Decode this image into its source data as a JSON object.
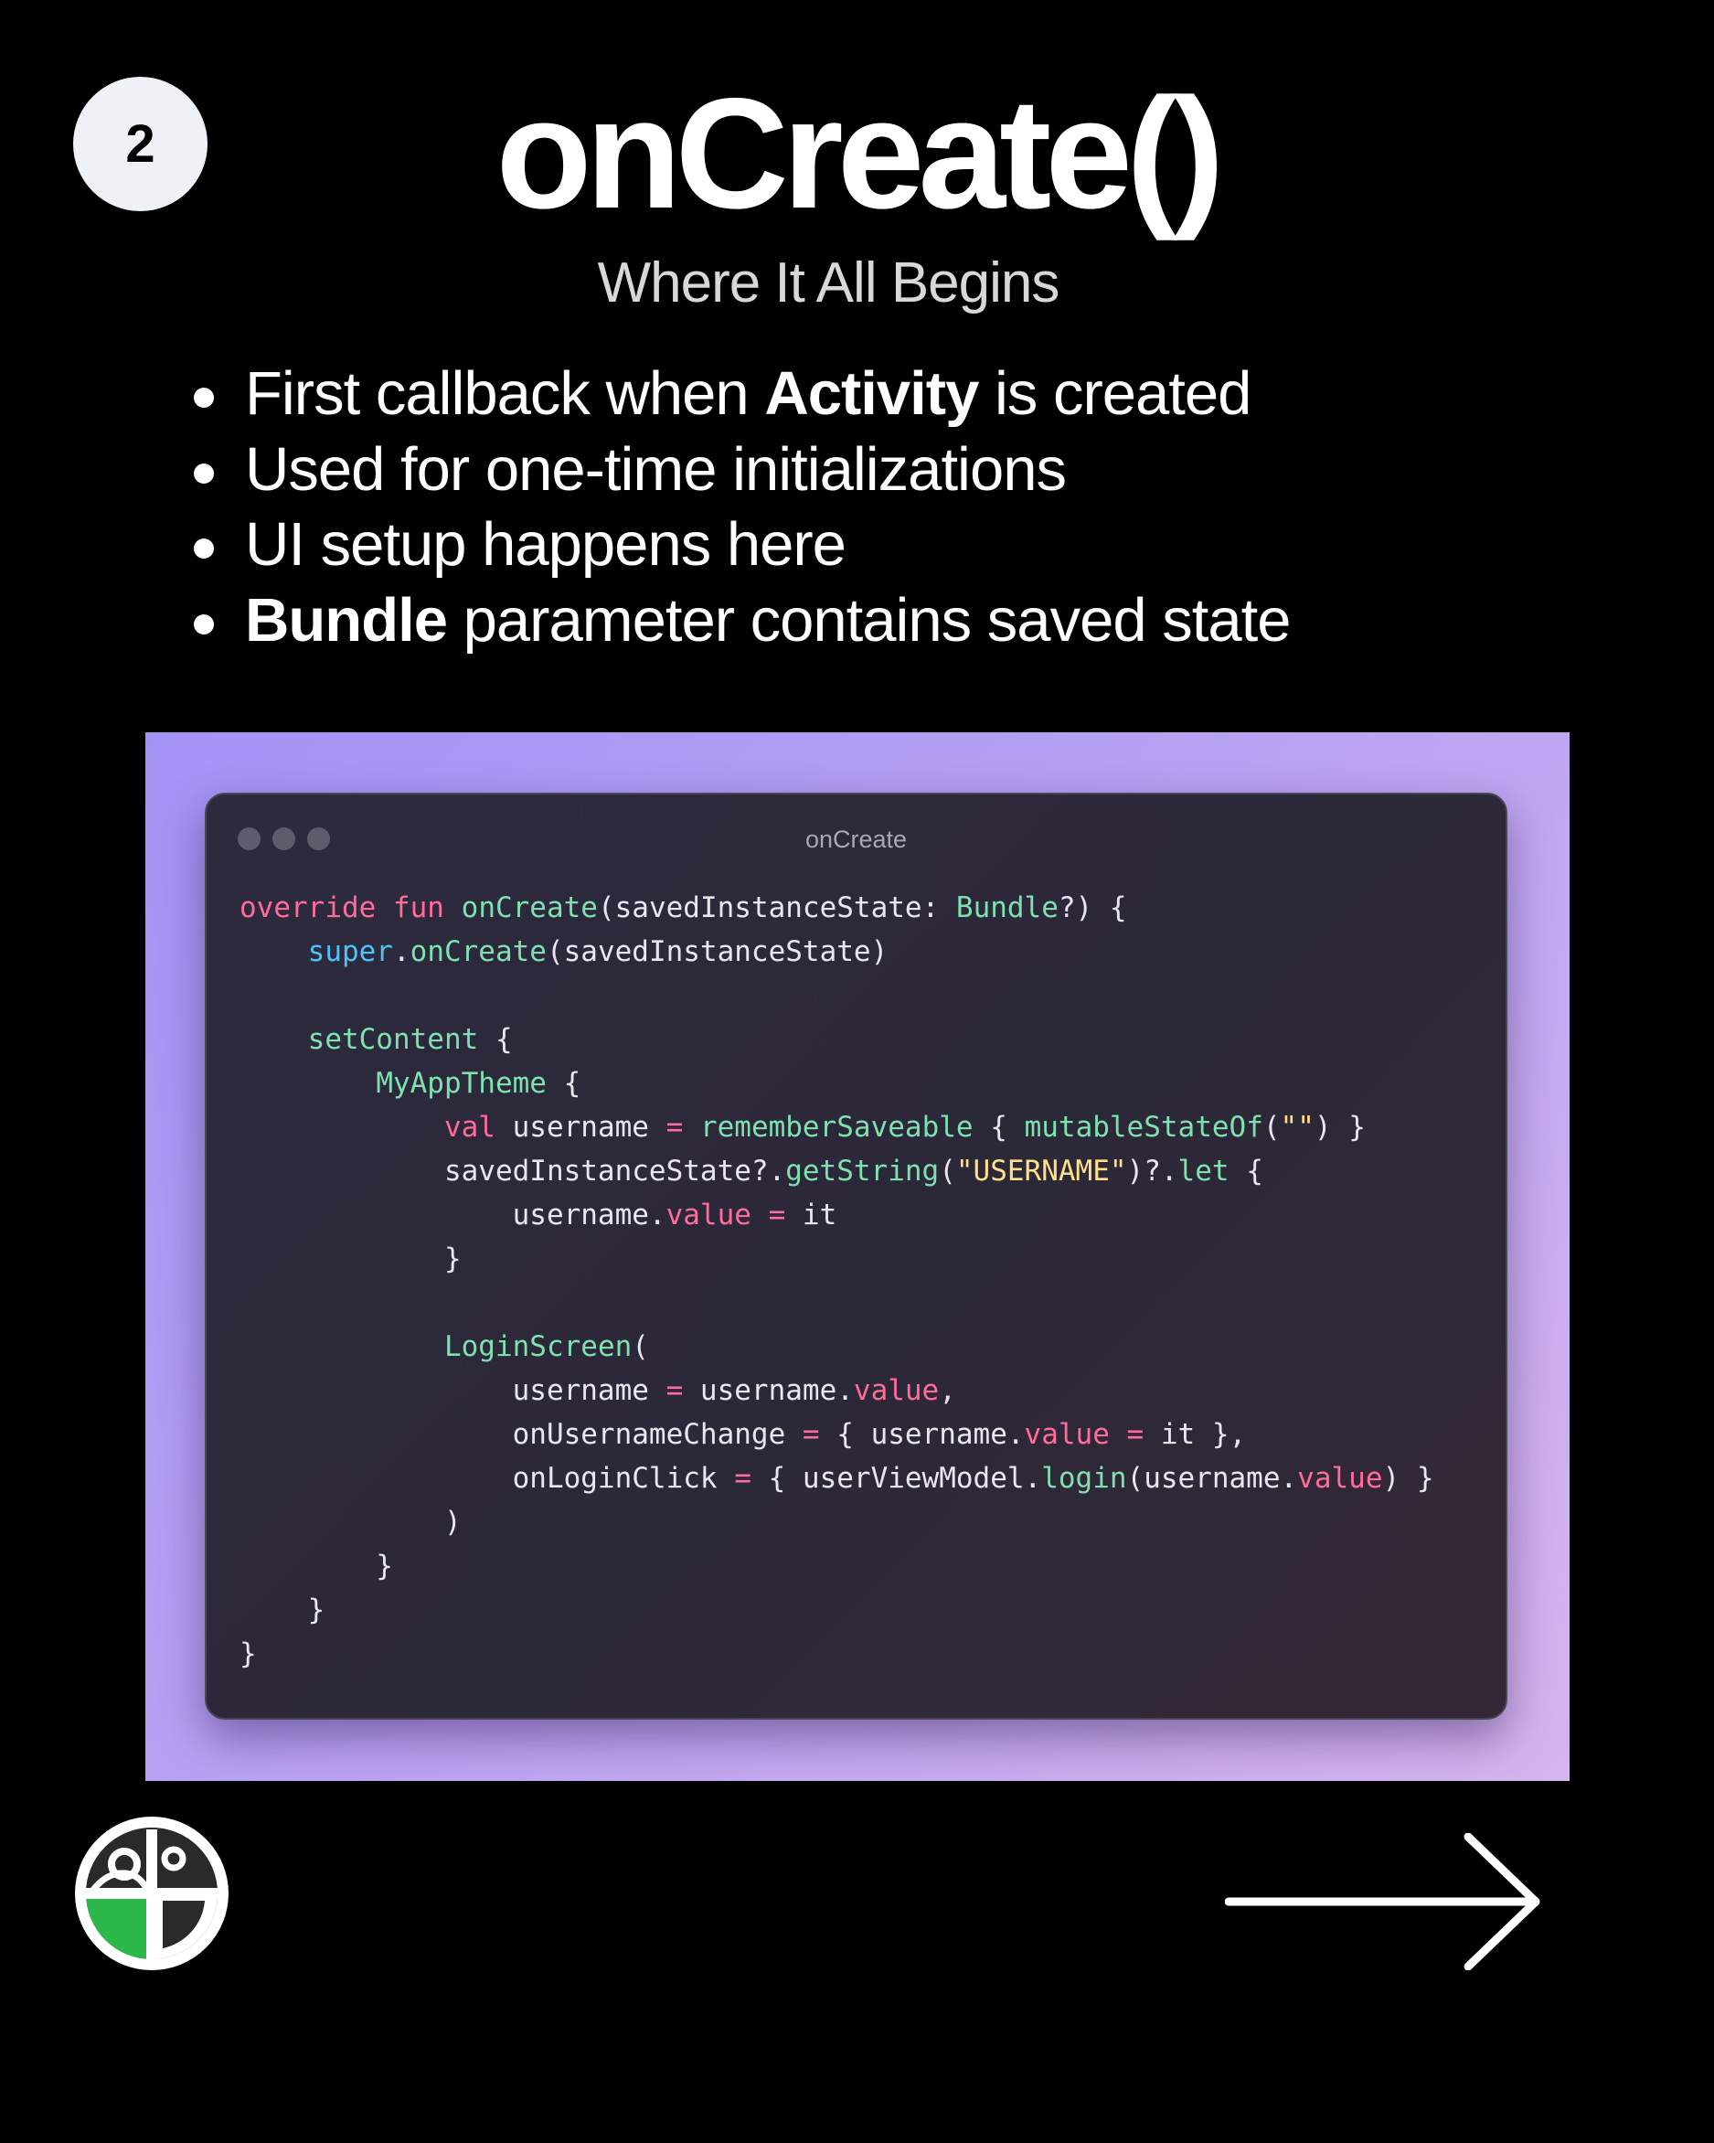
{
  "badge": {
    "number": "2"
  },
  "title": "onCreate()",
  "subtitle": "Where It All Begins",
  "bullets": [
    {
      "pre": "First callback when ",
      "bold": "Activity",
      "post": " is created"
    },
    {
      "pre": "Used for one-time initializations",
      "bold": "",
      "post": ""
    },
    {
      "pre": "UI setup happens here",
      "bold": "",
      "post": ""
    },
    {
      "pre": "",
      "bold": "Bundle",
      "post": " parameter contains saved state"
    }
  ],
  "code_window": {
    "title": "onCreate",
    "lines": [
      [
        [
          "kw",
          "override"
        ],
        [
          "t",
          " "
        ],
        [
          "kw",
          "fun"
        ],
        [
          "t",
          " "
        ],
        [
          "fn",
          "onCreate"
        ],
        [
          "t",
          "(savedInstanceState: "
        ],
        [
          "ty",
          "Bundle"
        ],
        [
          "t",
          "?) {"
        ]
      ],
      [
        [
          "t",
          "    "
        ],
        [
          "super",
          "super"
        ],
        [
          "t",
          "."
        ],
        [
          "fn",
          "onCreate"
        ],
        [
          "t",
          "(savedInstanceState)"
        ]
      ],
      [
        [
          "t",
          ""
        ]
      ],
      [
        [
          "t",
          "    "
        ],
        [
          "fn",
          "setContent"
        ],
        [
          "t",
          " {"
        ]
      ],
      [
        [
          "t",
          "        "
        ],
        [
          "fn",
          "MyAppTheme"
        ],
        [
          "t",
          " {"
        ]
      ],
      [
        [
          "t",
          "            "
        ],
        [
          "kw",
          "val"
        ],
        [
          "t",
          " username "
        ],
        [
          "op",
          "="
        ],
        [
          "t",
          " "
        ],
        [
          "fn",
          "rememberSaveable"
        ],
        [
          "t",
          " { "
        ],
        [
          "fn",
          "mutableStateOf"
        ],
        [
          "t",
          "("
        ],
        [
          "str",
          "\"\""
        ],
        [
          "t",
          ") }"
        ]
      ],
      [
        [
          "t",
          "            savedInstanceState?."
        ],
        [
          "fn",
          "getString"
        ],
        [
          "t",
          "("
        ],
        [
          "str",
          "\"USERNAME\""
        ],
        [
          "t",
          ")?."
        ],
        [
          "fn",
          "let"
        ],
        [
          "t",
          " {"
        ]
      ],
      [
        [
          "t",
          "                username."
        ],
        [
          "prop",
          "value"
        ],
        [
          "t",
          " "
        ],
        [
          "op",
          "="
        ],
        [
          "t",
          " it"
        ]
      ],
      [
        [
          "t",
          "            }"
        ]
      ],
      [
        [
          "t",
          ""
        ]
      ],
      [
        [
          "t",
          "            "
        ],
        [
          "fn",
          "LoginScreen"
        ],
        [
          "t",
          "("
        ]
      ],
      [
        [
          "t",
          "                username "
        ],
        [
          "op",
          "="
        ],
        [
          "t",
          " username."
        ],
        [
          "prop",
          "value"
        ],
        [
          "t",
          ","
        ]
      ],
      [
        [
          "t",
          "                onUsernameChange "
        ],
        [
          "op",
          "="
        ],
        [
          "t",
          " { username."
        ],
        [
          "prop",
          "value"
        ],
        [
          "t",
          " "
        ],
        [
          "op",
          "="
        ],
        [
          "t",
          " it },"
        ]
      ],
      [
        [
          "t",
          "                onLoginClick "
        ],
        [
          "op",
          "="
        ],
        [
          "t",
          " { userViewModel."
        ],
        [
          "fn",
          "login"
        ],
        [
          "t",
          "(username."
        ],
        [
          "prop",
          "value"
        ],
        [
          "t",
          ") }"
        ]
      ],
      [
        [
          "t",
          "            )"
        ]
      ],
      [
        [
          "t",
          "        }"
        ]
      ],
      [
        [
          "t",
          "    }"
        ]
      ],
      [
        [
          "t",
          "}"
        ]
      ]
    ]
  },
  "colors": {
    "background": "#000000",
    "keyword": "#ff6b9a",
    "function": "#7fe0b0",
    "super": "#4fc3f7",
    "string": "#ffe08a",
    "logo_green": "#2db84b"
  },
  "icons": {
    "logo": "brand-logo-icon",
    "next": "arrow-right-icon"
  }
}
